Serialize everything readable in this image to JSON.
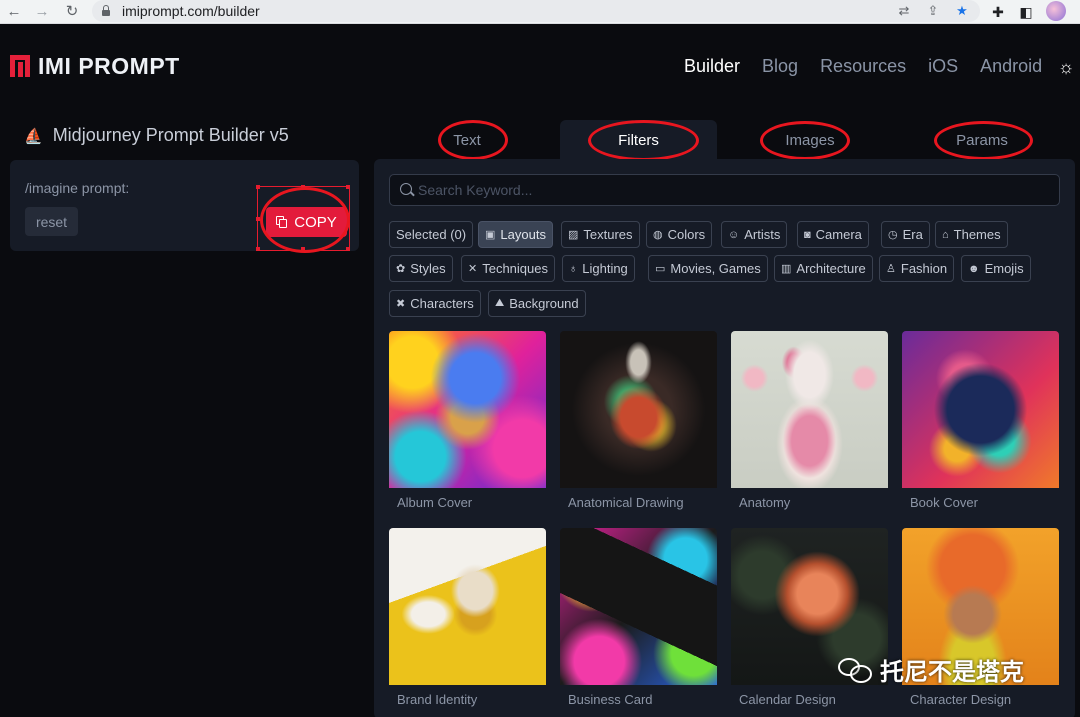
{
  "browser": {
    "url": "imiprompt.com/builder",
    "icons": [
      "back-icon",
      "forward-icon",
      "reload-icon",
      "lock-icon",
      "translate-icon",
      "share-icon",
      "bookmark-star-icon",
      "extensions-icon",
      "side-panel-icon",
      "profile-avatar"
    ]
  },
  "header": {
    "logo_text": "IMI PROMPT",
    "nav": [
      "Builder",
      "Blog",
      "Resources",
      "iOS",
      "Android"
    ],
    "active_nav": "Builder"
  },
  "builder": {
    "title": "Midjourney Prompt Builder v5",
    "prompt_label": "/imagine prompt:",
    "reset_label": "reset",
    "copy_label": "COPY"
  },
  "tabs": [
    "Text",
    "Filters",
    "Images",
    "Params"
  ],
  "active_tab": "Filters",
  "search": {
    "placeholder": "Search Keyword..."
  },
  "filters": [
    {
      "label": "Selected (0)",
      "icon": ""
    },
    {
      "label": "Layouts",
      "icon": "▣"
    },
    {
      "label": "Textures",
      "icon": "▨"
    },
    {
      "label": "Colors",
      "icon": "◍"
    },
    {
      "label": "Artists",
      "icon": "☺"
    },
    {
      "label": "Camera",
      "icon": "◙"
    },
    {
      "label": "Era",
      "icon": "◷"
    },
    {
      "label": "Themes",
      "icon": "⌂"
    },
    {
      "label": "Styles",
      "icon": "✿"
    },
    {
      "label": "Techniques",
      "icon": "✕"
    },
    {
      "label": "Lighting",
      "icon": "♁"
    },
    {
      "label": "Movies, Games",
      "icon": "▭"
    },
    {
      "label": "Architecture",
      "icon": "▥"
    },
    {
      "label": "Fashion",
      "icon": "♙"
    },
    {
      "label": "Emojis",
      "icon": "☻"
    },
    {
      "label": "Characters",
      "icon": "✖"
    },
    {
      "label": "Background",
      "icon": "⛰"
    }
  ],
  "active_filter": "Layouts",
  "cards": [
    {
      "caption": "Album Cover"
    },
    {
      "caption": "Anatomical Drawing"
    },
    {
      "caption": "Anatomy"
    },
    {
      "caption": "Book Cover"
    },
    {
      "caption": "Brand Identity"
    },
    {
      "caption": "Business Card"
    },
    {
      "caption": "Calendar Design"
    },
    {
      "caption": "Character Design"
    }
  ],
  "watermark": {
    "text": "托尼不是塔克"
  },
  "colors": {
    "accent": "#e31b3b",
    "annotation_ring": "#e8161f",
    "background": "#0a0b0f",
    "panel": "#161b26"
  }
}
